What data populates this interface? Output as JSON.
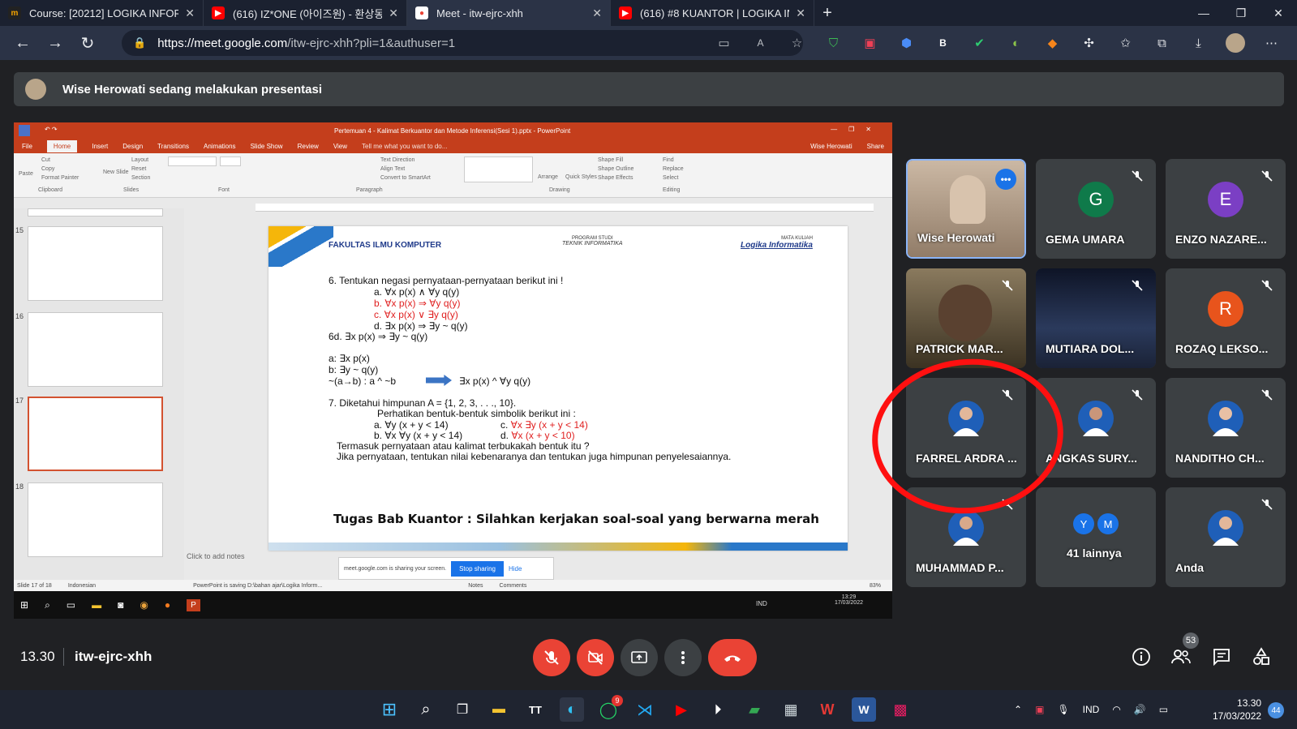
{
  "browser": {
    "tabs": [
      {
        "title": "Course: [20212] LOGIKA INFORM",
        "fav": "m"
      },
      {
        "title": "(616) IZ*ONE (아이즈원) - 환상동",
        "fav": "▶"
      },
      {
        "title": "Meet - itw-ejrc-xhh",
        "fav": "●"
      },
      {
        "title": "(616) #8 KUANTOR | LOGIKA INF",
        "fav": "▶"
      }
    ],
    "url_host": "https://meet.google.com",
    "url_path": "/itw-ejrc-xhh?pli=1&authuser=1"
  },
  "banner": {
    "text": "Wise Herowati sedang melakukan presentasi"
  },
  "powerpoint": {
    "title": "Pertemuan 4 - Kalimat Berkuantor dan Metode Inferensi(Sesi 1).pptx - PowerPoint",
    "menu": [
      "File",
      "Home",
      "Insert",
      "Design",
      "Transitions",
      "Animations",
      "Slide Show",
      "Review",
      "View",
      "Tell me what you want to do...",
      "Wise Herowati",
      "Share"
    ],
    "ribbon_groups": [
      "Clipboard",
      "Slides",
      "Font",
      "Paragraph",
      "Drawing",
      "Editing"
    ],
    "ribbon_items": [
      "Cut",
      "Copy",
      "Format Painter",
      "Paste",
      "New Slide",
      "Layout",
      "Reset",
      "Section",
      "Text Direction",
      "Align Text",
      "Convert to SmartArt",
      "Arrange",
      "Quick Styles",
      "Shape Fill",
      "Shape Outline",
      "Shape Effects",
      "Find",
      "Replace",
      "Select"
    ],
    "thumb_numbers": [
      "15",
      "16",
      "17",
      "18"
    ],
    "notes_placeholder": "Click to add notes",
    "status_left": "Slide 17 of 18",
    "status_lang": "Indonesian",
    "status_save": "PowerPoint is saving D:\\bahan ajar\\Logika Inform...",
    "status_notes": "Notes",
    "status_comments": "Comments",
    "zoom": "83%",
    "share_text": "meet.google.com is sharing your screen.",
    "share_stop": "Stop sharing",
    "share_hide": "Hide",
    "inner_time": "13:29",
    "inner_date": "17/03/2022",
    "inner_lang": "IND"
  },
  "slide": {
    "faculty": "FAKULTAS ILMU KOMPUTER",
    "prog_label": "PROGRAM STUDI",
    "prog_name": "TEKNIK INFORMATIKA",
    "mk_label": "MATA KULIAH",
    "mk_name": "Logika Informatika",
    "q6": "6. Tentukan negasi pernyataan-pernyataan berikut ini !",
    "q6a": "a. ∀x p(x) ∧ ∀y q(y)",
    "q6b": "b. ∀x p(x) ⇒ ∀y q(y)",
    "q6c": "c. ∀x p(x) ∨ ∃y q(y)",
    "q6d": "d. ∃x p(x) ⇒ ∃y ~ q(y)",
    "a6d": "6d. ∃x p(x) ⇒ ∃y ~ q(y)",
    "w1": "a: ∃x p(x)",
    "w2": "b: ∃y ~ q(y)",
    "w3": "~(a→b) : a ^ ~b",
    "w4": "∃x p(x) ^ ∀y q(y)",
    "q7": "7. Diketahui himpunan A = {1, 2, 3, . . ., 10}.",
    "q7s": "Perhatikan bentuk-bentuk simbolik berikut ini :",
    "q7a": "a. ∀y (x + y < 14)",
    "q7b": "b. ∀x ∀y (x + y < 14)",
    "q7c_label": "c. ",
    "q7c": "∀x ∃y (x + y < 14)",
    "q7d_label": "d. ",
    "q7d": "∀x (x + y < 10)",
    "q7q1": "Termasuk pernyataan atau kalimat terbukakah bentuk itu ?",
    "q7q2": "Jika pernyataan, tentukan nilai kebenaranya dan tentukan juga himpunan penyelesaiannya.",
    "task": "Tugas Bab Kuantor : Silahkan kerjakan soal-soal yang berwarna merah"
  },
  "participants": [
    {
      "name": "Wise Herowati",
      "initial": "",
      "color": "#8a7a6a"
    },
    {
      "name": "GEMA UMARA",
      "initial": "G",
      "color": "#0f7a4a"
    },
    {
      "name": "ENZO NAZARE...",
      "initial": "E",
      "color": "#7b3fc4"
    },
    {
      "name": "PATRICK MAR...",
      "initial": "",
      "color": "#444"
    },
    {
      "name": "MUTIARA DOL...",
      "initial": "",
      "color": "#1b2540"
    },
    {
      "name": "ROZAQ LEKSO...",
      "initial": "R",
      "color": "#e8541c"
    },
    {
      "name": "FARREL ARDRA ...",
      "initial": "",
      "color": "#1f5fb8"
    },
    {
      "name": "ANGKAS SURY...",
      "initial": "",
      "color": "#1f5fb8"
    },
    {
      "name": "NANDITHO CH...",
      "initial": "",
      "color": "#1f5fb8"
    },
    {
      "name": "MUHAMMAD P...",
      "initial": "",
      "color": "#1f5fb8"
    },
    {
      "name": "41 lainnya",
      "initial": "",
      "color": "#3c4043"
    },
    {
      "name": "Anda",
      "initial": "",
      "color": "#1f5fb8"
    }
  ],
  "others_initials": [
    "Y",
    "M"
  ],
  "controls": {
    "time": "13.30",
    "code": "itw-ejrc-xhh",
    "people_count": "53"
  },
  "taskbar": {
    "time": "13.30",
    "date": "17/03/2022",
    "lang": "IND",
    "notif": "44",
    "whatsapp_badge": "9"
  }
}
